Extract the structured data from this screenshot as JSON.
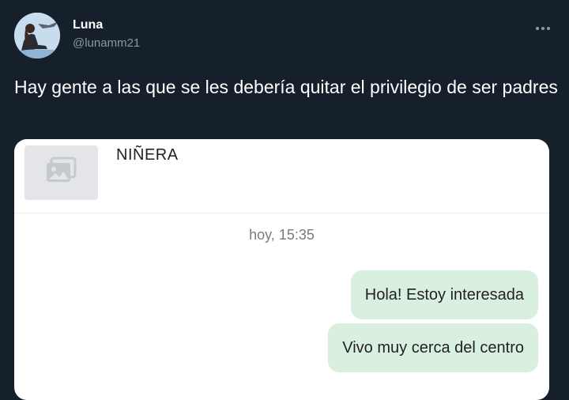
{
  "tweet": {
    "author": {
      "display_name": "Luna",
      "handle": "@lunamm21"
    },
    "more_icon": "more-horizontal-icon",
    "text": "Hay gente a las que se les debería quitar el privilegio de ser padres"
  },
  "chat": {
    "contact_name": "NIÑERA",
    "contact_photo_icon": "image-placeholder-icon",
    "timestamp": "hoy, 15:35",
    "messages": [
      {
        "text": "Hola! Estoy interesada"
      },
      {
        "text": "Vivo muy cerca del centro"
      }
    ]
  },
  "colors": {
    "background": "#15202b",
    "handle": "#8b98a5",
    "bubble": "#d9efe0"
  }
}
